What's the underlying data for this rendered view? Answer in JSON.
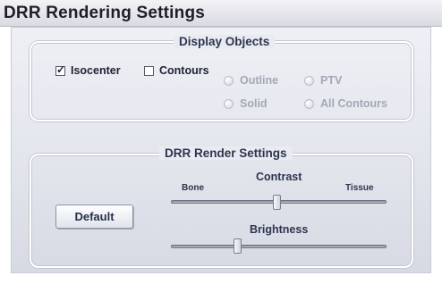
{
  "window": {
    "title": "DRR Rendering Settings"
  },
  "display_objects": {
    "title": "Display Objects",
    "isocenter": {
      "label": "Isocenter",
      "checked": true
    },
    "contours": {
      "label": "Contours",
      "checked": false
    },
    "radios": [
      {
        "label": "Outline",
        "enabled": false
      },
      {
        "label": "PTV",
        "enabled": false
      },
      {
        "label": "Solid",
        "enabled": false
      },
      {
        "label": "All Contours",
        "enabled": false
      }
    ]
  },
  "render_settings": {
    "title": "DRR Render Settings",
    "default_button": "Default",
    "contrast": {
      "label": "Contrast",
      "min_label": "Bone",
      "max_label": "Tissue",
      "value": 0.49
    },
    "brightness": {
      "label": "Brightness",
      "value": 0.3
    }
  }
}
